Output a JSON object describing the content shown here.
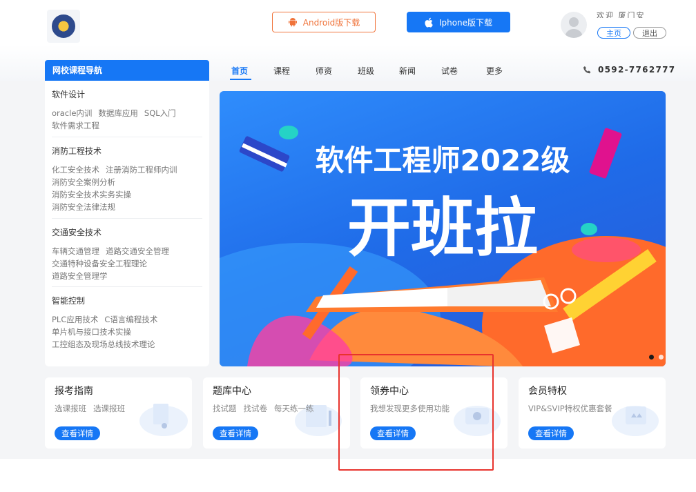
{
  "header": {
    "android_label": "Android版下载",
    "iphone_label": "Iphone版下载",
    "welcome_text": "欢迎 厦门安",
    "home_label": "主页",
    "exit_label": "退出"
  },
  "nav": {
    "course_nav_title": "网校课程导航",
    "items": [
      "首页",
      "课程",
      "师资",
      "班级",
      "新闻",
      "试卷",
      "更多"
    ],
    "active_index": 0,
    "phone": "0592-7762777"
  },
  "sidebar": {
    "categories": [
      {
        "title": "软件设计",
        "links": [
          "oracle内训",
          "数据库应用",
          "SQL入门",
          "软件需求工程"
        ]
      },
      {
        "title": "消防工程技术",
        "links": [
          "化工安全技术",
          "注册消防工程师内训",
          "消防安全案例分析",
          "消防安全技术实务实操",
          "消防安全法律法规"
        ]
      },
      {
        "title": "交通安全技术",
        "links": [
          "车辆交通管理",
          "道路交通安全管理",
          "交通特种设备安全工程理论",
          "道路安全管理学"
        ]
      },
      {
        "title": "智能控制",
        "links": [
          "PLC应用技术",
          "C语言编程技术",
          "单片机与接口技术实操",
          "工控组态及现场总线技术理论"
        ]
      }
    ]
  },
  "banner": {
    "headline": "软件工程师2022级",
    "subheadline": "开班拉"
  },
  "cards": [
    {
      "title": "报考指南",
      "desc": [
        "选课报班",
        "选课报班"
      ],
      "button": "查看详情"
    },
    {
      "title": "题库中心",
      "desc": [
        "找试题",
        "找试卷",
        "每天练一练"
      ],
      "button": "查看详情"
    },
    {
      "title": "领券中心",
      "desc": [
        "我想发现更多使用功能"
      ],
      "button": "查看详情"
    },
    {
      "title": "会员特权",
      "desc": [
        "VIP&SVIP特权优惠套餐"
      ],
      "button": "查看详情"
    }
  ],
  "colors": {
    "primary": "#1677f5",
    "android": "#f0733a",
    "highlight": "#e8332d"
  }
}
